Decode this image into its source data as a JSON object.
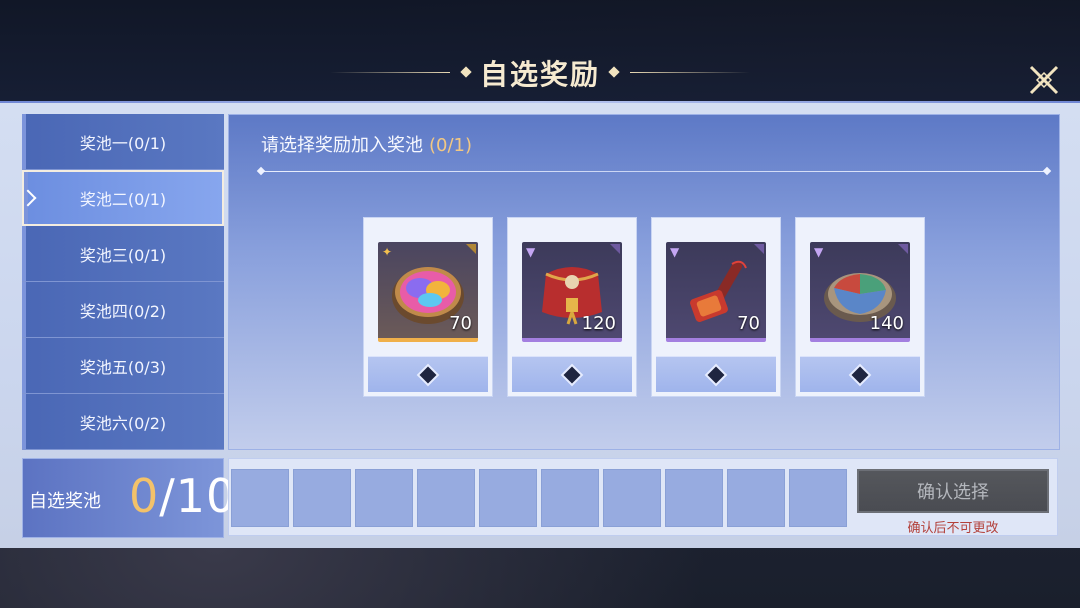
{
  "header": {
    "title": "自选奖励"
  },
  "sidebar": {
    "items": [
      {
        "label": "奖池一(0/1)"
      },
      {
        "label": "奖池二(0/1)"
      },
      {
        "label": "奖池三(0/1)"
      },
      {
        "label": "奖池四(0/2)"
      },
      {
        "label": "奖池五(0/3)"
      },
      {
        "label": "奖池六(0/2)"
      }
    ],
    "selected_index": 1
  },
  "main": {
    "prompt": "请选择奖励加入奖池",
    "prompt_count": "(0/1)",
    "rewards": [
      {
        "icon": "rainbow-paint-tray-icon",
        "quantity": "70",
        "rarity": "gold"
      },
      {
        "icon": "red-gift-bag-icon",
        "quantity": "120",
        "rarity": "purple"
      },
      {
        "icon": "red-hammer-icon",
        "quantity": "70",
        "rarity": "purple"
      },
      {
        "icon": "tricolor-tray-icon",
        "quantity": "140",
        "rarity": "purple"
      }
    ]
  },
  "pool": {
    "label": "自选奖池",
    "current": "0",
    "separator": "/",
    "max": "10",
    "slot_count": 10
  },
  "confirm": {
    "button_label": "确认选择",
    "note": "确认后不可更改"
  },
  "colors": {
    "accent_gold": "#f3c26a",
    "tab_blue": "#4a67b5",
    "warning_red": "#b3403a"
  }
}
